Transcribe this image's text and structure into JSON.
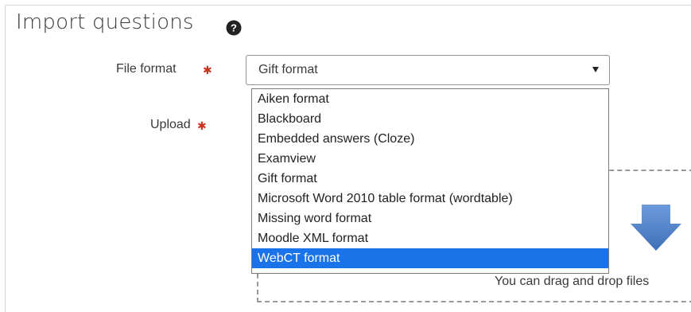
{
  "page": {
    "title": "Import questions"
  },
  "icons": {
    "help": "question-circle-icon",
    "required": "asterisk-icon",
    "dropdown_caret": "caret-down-icon",
    "drop_arrow": "arrow-down-icon"
  },
  "form": {
    "file_format": {
      "label": "File format",
      "selected_value": "Gift format",
      "options": [
        "Aiken format",
        "Blackboard",
        "Embedded answers (Cloze)",
        "Examview",
        "Gift format",
        "Microsoft Word 2010 table format (wordtable)",
        "Missing word format",
        "Moodle XML format",
        "WebCT format"
      ],
      "highlighted_option": "WebCT format"
    },
    "upload": {
      "label": "Upload",
      "drop_hint": "You can drag and drop files"
    }
  },
  "colors": {
    "required": "#ca3120",
    "highlight": "#1a73e8",
    "arrow": "#4a7ec9"
  }
}
